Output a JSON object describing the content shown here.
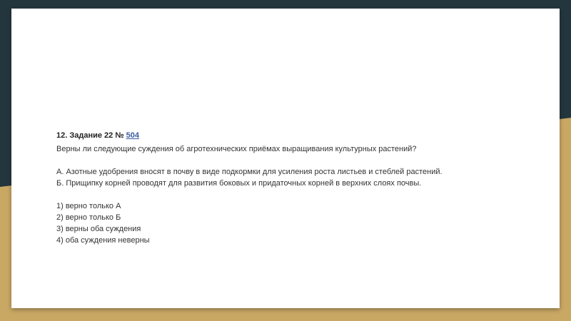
{
  "colors": {
    "background_dark": "#24363d",
    "background_gold": "#c9a864",
    "slide": "#ffffff",
    "link": "#3a5ba0"
  },
  "task": {
    "heading": "12. Задание 22 №",
    "number_link": "504",
    "question": "Верны ли следующие суждения об агротехнических приёмах выращивания культурных растений?",
    "statements": [
      "А. Азотные удобрения вносят в почву в виде подкормки для усиления роста листьев и стеблей растений.",
      "Б.  Прищипку корней проводят для развития боковых и придаточных корней в верхних слоях почвы."
    ],
    "options": [
      "1) верно только А",
      "2) верно только Б",
      "3) верны оба суждения",
      "4) оба суждения неверны"
    ]
  }
}
